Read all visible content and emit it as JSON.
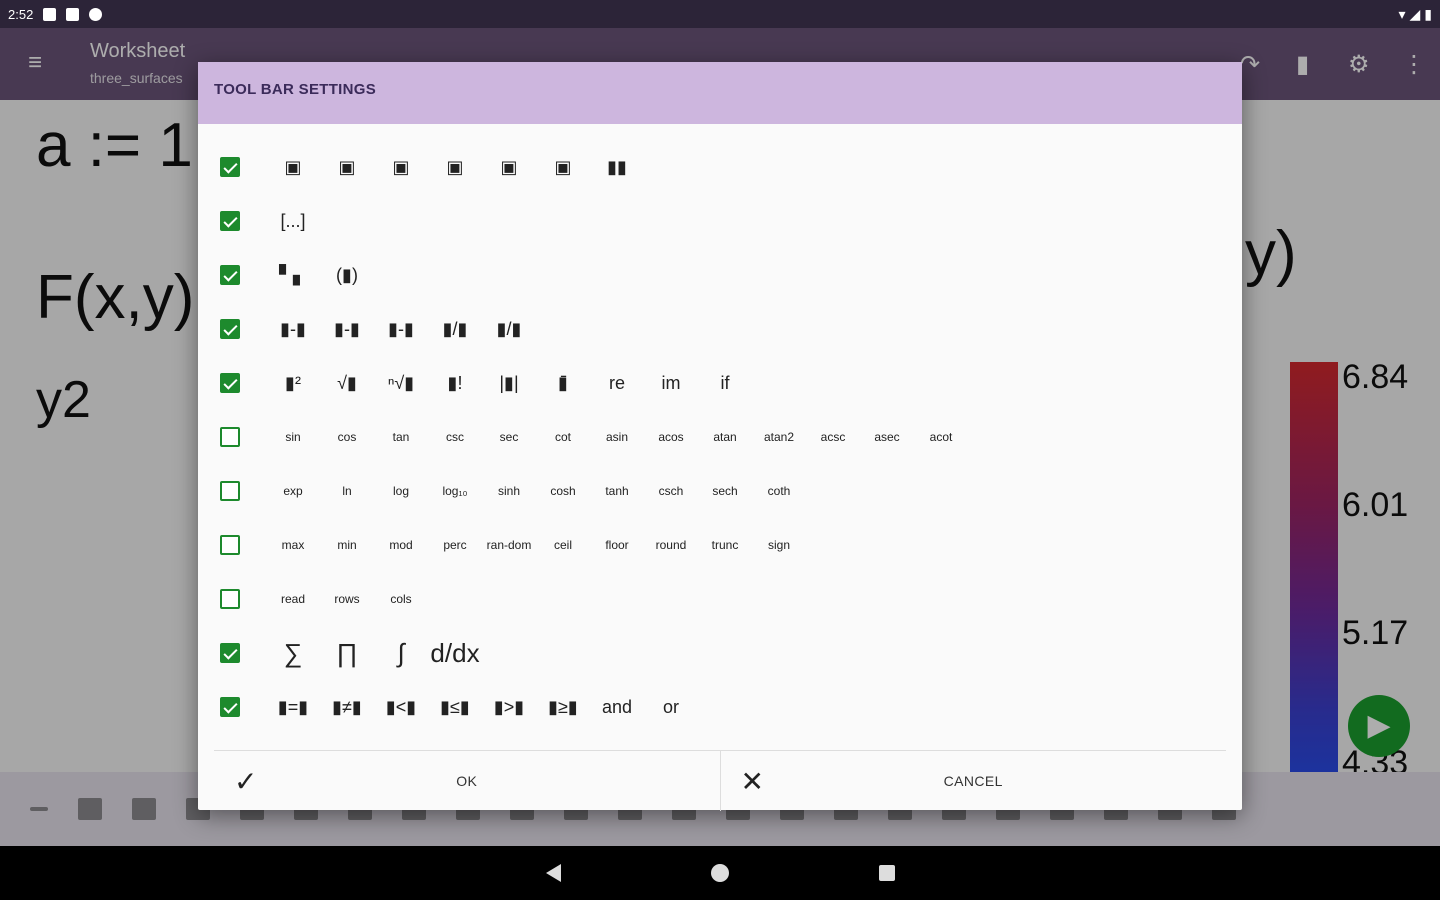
{
  "status_bar": {
    "time": "2:52"
  },
  "app_bar": {
    "title": "Worksheet",
    "subtitle": "three_surfaces"
  },
  "worksheet": {
    "line1": "a := 1.",
    "line2": "F(x,y)",
    "line2_tail": "y)",
    "line3": "y2",
    "colorbar_labels": [
      "6.84",
      "6.01",
      "5.17",
      "4.33"
    ]
  },
  "dialog": {
    "title": "TOOL BAR SETTINGS",
    "rows": [
      {
        "checked": true,
        "items": [
          "▣",
          "▣",
          "▣",
          "▣",
          "▣",
          "▣",
          "▮▮"
        ]
      },
      {
        "checked": true,
        "items": [
          "[...]"
        ]
      },
      {
        "checked": true,
        "items": [
          "▘▖",
          "(▮)"
        ]
      },
      {
        "checked": true,
        "items": [
          "▮-▮",
          "▮-▮",
          "▮-▮",
          "▮/▮",
          "▮/▮"
        ]
      },
      {
        "checked": true,
        "items": [
          "▮²",
          "√▮",
          "ⁿ√▮",
          "▮!",
          "|▮|",
          "▮̄",
          "re",
          "im",
          "if"
        ]
      },
      {
        "checked": false,
        "items": [
          "sin",
          "cos",
          "tan",
          "csc",
          "sec",
          "cot",
          "asin",
          "acos",
          "atan",
          "atan2",
          "acsc",
          "asec",
          "acot"
        ]
      },
      {
        "checked": false,
        "items": [
          "exp",
          "ln",
          "log",
          "log₁₀",
          "sinh",
          "cosh",
          "tanh",
          "csch",
          "sech",
          "coth"
        ]
      },
      {
        "checked": false,
        "items": [
          "max",
          "min",
          "mod",
          "perc",
          "ran-dom",
          "ceil",
          "floor",
          "round",
          "trunc",
          "sign"
        ]
      },
      {
        "checked": false,
        "items": [
          "read",
          "rows",
          "cols"
        ]
      },
      {
        "checked": true,
        "items": [
          "∑",
          "∏",
          "∫",
          "d/dx"
        ]
      },
      {
        "checked": true,
        "items": [
          "▮=▮",
          "▮≠▮",
          "▮<▮",
          "▮≤▮",
          "▮>▮",
          "▮≥▮",
          "and",
          "or"
        ]
      }
    ],
    "ok_label": "OK",
    "cancel_label": "CANCEL"
  },
  "colors": {
    "accent": "#1d8a2d",
    "header": "#cdb6de",
    "appbar": "#6a5479"
  }
}
